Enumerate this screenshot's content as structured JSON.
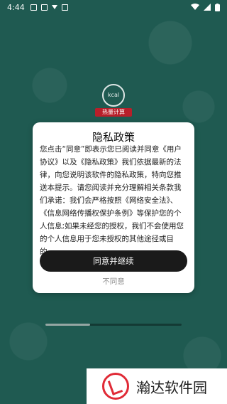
{
  "status_bar": {
    "time": "4:44"
  },
  "logo": {
    "circle_text": "kcal",
    "badge_text": "热量计算"
  },
  "dialog": {
    "title": "隐私政策",
    "body": "您点击“同意”即表示您已阅读并同意《用户协议》以及《隐私政策》我们依据最新的法律，向您说明该软件的隐私政策，特向您推送本提示。请您阅读并充分理解相关条款我们承诺：我们会严格按照《网络安全法》、《信息网络传播权保护条例》等保护您的个人信息;如果未经您的授权，我们不会使用您的个人信息用于您未授权的其他途径或目的。",
    "agree_label": "同意并继续",
    "disagree_label": "不同意"
  },
  "progress": {
    "value": 0.33
  },
  "watermark": {
    "text": "瀚达软件园"
  },
  "colors": {
    "background": "#1f5a51",
    "primary_button": "#1a1a1a",
    "badge": "#b81f2a",
    "watermark_red": "#e02a36"
  }
}
